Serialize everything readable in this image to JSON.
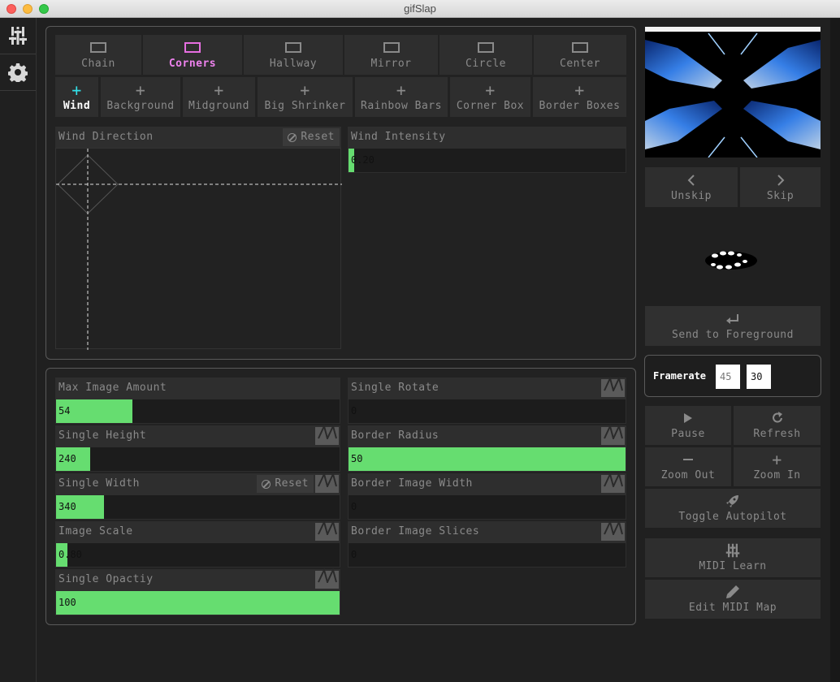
{
  "window": {
    "title": "gifSlap"
  },
  "sidebar": {
    "items": [
      {
        "icon": "sliders-icon",
        "label": "Controls"
      },
      {
        "icon": "gear-icon",
        "label": "Settings"
      }
    ]
  },
  "modes": {
    "items": [
      {
        "label": "Chain",
        "active": false
      },
      {
        "label": "Corners",
        "active": true
      },
      {
        "label": "Hallway",
        "active": false
      },
      {
        "label": "Mirror",
        "active": false
      },
      {
        "label": "Circle",
        "active": false
      },
      {
        "label": "Center",
        "active": false
      }
    ]
  },
  "layers": {
    "items": [
      {
        "label": "Wind",
        "active": true
      },
      {
        "label": "Background",
        "active": false
      },
      {
        "label": "Midground",
        "active": false
      },
      {
        "label": "Big Shrinker",
        "active": false
      },
      {
        "label": "Rainbow Bars",
        "active": false
      },
      {
        "label": "Corner Box",
        "active": false
      },
      {
        "label": "Border Boxes",
        "active": false
      }
    ]
  },
  "wind": {
    "direction_label": "Wind Direction",
    "reset_label": "Reset",
    "intensity_label": "Wind Intensity",
    "intensity_value": "0.20",
    "intensity_fraction": 0.02
  },
  "controls": {
    "reset_label": "Reset",
    "left": [
      {
        "label": "Max Image Amount",
        "value": "54",
        "fraction": 0.27,
        "wave": false,
        "reset": false
      },
      {
        "label": "Single Height",
        "value": "240",
        "fraction": 0.12,
        "wave": true,
        "reset": false
      },
      {
        "label": "Single Width",
        "value": "340",
        "fraction": 0.17,
        "wave": true,
        "reset": true
      },
      {
        "label": "Image Scale",
        "value": "0.80",
        "fraction": 0.04,
        "wave": true,
        "reset": false
      },
      {
        "label": "Single Opactiy",
        "value": "100",
        "fraction": 1.0,
        "wave": true,
        "reset": false
      }
    ],
    "right": [
      {
        "label": "Single Rotate",
        "value": "0",
        "fraction": 0,
        "wave": true
      },
      {
        "label": "Border Radius",
        "value": "50",
        "fraction": 1.0,
        "wave": true
      },
      {
        "label": "Border Image Width",
        "value": "0",
        "fraction": 0,
        "wave": true
      },
      {
        "label": "Border Image Slices",
        "value": "0",
        "fraction": 0,
        "wave": true
      }
    ]
  },
  "right_panel": {
    "unskip_label": "Unskip",
    "skip_label": "Skip",
    "send_label": "Send to Foreground",
    "framerate_label": "Framerate",
    "framerate_value_1": "45",
    "framerate_value_2": "30",
    "pause_label": "Pause",
    "refresh_label": "Refresh",
    "zoom_out_label": "Zoom Out",
    "zoom_in_label": "Zoom In",
    "autopilot_label": "Toggle Autopilot",
    "midi_learn_label": "MIDI Learn",
    "edit_midi_label": "Edit MIDI Map"
  },
  "colors": {
    "accent_green": "#66dd70",
    "active_mode": "#ee82ee",
    "active_layer": "#33e0e8"
  }
}
